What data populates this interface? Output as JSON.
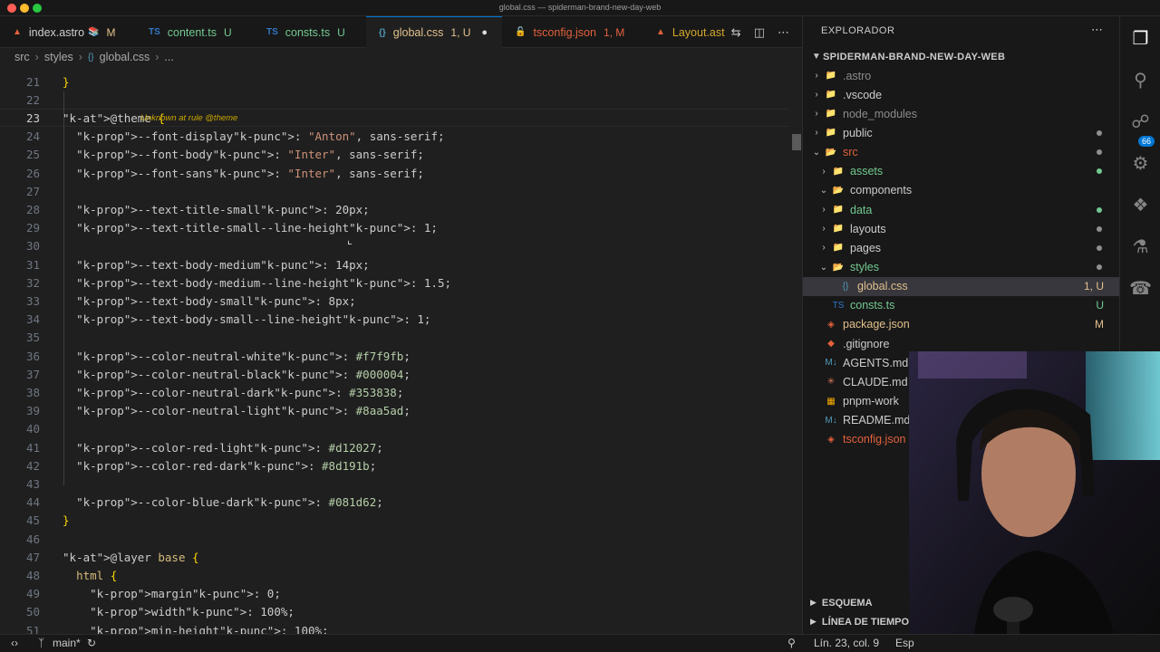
{
  "window": {
    "title": "global.css — spiderman-brand-new-day-web"
  },
  "tabs": [
    {
      "icon": "astro",
      "label": "index.astro",
      "status": "M",
      "extra": "📚"
    },
    {
      "icon": "TS",
      "label": "content.ts",
      "status": "U"
    },
    {
      "icon": "TS",
      "label": "consts.ts",
      "status": "U"
    },
    {
      "icon": "{}",
      "label": "global.css",
      "status": "1, U",
      "dirty": "●"
    },
    {
      "icon": "{}",
      "label": "tsconfig.json",
      "status": "1, M"
    },
    {
      "icon": "astro",
      "label": "Layout.ast"
    }
  ],
  "breadcrumb": {
    "seg1": "src",
    "seg2": "styles",
    "seg3_icon": "{}",
    "seg3": "global.css",
    "seg4": "..."
  },
  "editor": {
    "diagnostic": "Unknown at rule @theme",
    "lines": [
      {
        "n": "21",
        "text": "}"
      },
      {
        "n": "22",
        "text": ""
      },
      {
        "n": "23",
        "text": "@theme {"
      },
      {
        "n": "24",
        "text": "  --font-display: \"Anton\", sans-serif;"
      },
      {
        "n": "25",
        "text": "  --font-body: \"Inter\", sans-serif;"
      },
      {
        "n": "26",
        "text": "  --font-sans: \"Inter\", sans-serif;"
      },
      {
        "n": "27",
        "text": ""
      },
      {
        "n": "28",
        "text": "  --text-title-small: 20px;"
      },
      {
        "n": "29",
        "text": "  --text-title-small--line-height: 1;"
      },
      {
        "n": "30",
        "text": ""
      },
      {
        "n": "31",
        "text": "  --text-body-medium: 14px;"
      },
      {
        "n": "32",
        "text": "  --text-body-medium--line-height: 1.5;"
      },
      {
        "n": "33",
        "text": "  --text-body-small: 8px;"
      },
      {
        "n": "34",
        "text": "  --text-body-small--line-height: 1;"
      },
      {
        "n": "35",
        "text": ""
      },
      {
        "n": "36",
        "text": "  --color-neutral-white: #f7f9fb;"
      },
      {
        "n": "37",
        "text": "  --color-neutral-black: #000004;"
      },
      {
        "n": "38",
        "text": "  --color-neutral-dark: #353838;"
      },
      {
        "n": "39",
        "text": "  --color-neutral-light: #8aa5ad;"
      },
      {
        "n": "40",
        "text": ""
      },
      {
        "n": "41",
        "text": "  --color-red-light: #d12027;"
      },
      {
        "n": "42",
        "text": "  --color-red-dark: #8d191b;"
      },
      {
        "n": "43",
        "text": ""
      },
      {
        "n": "44",
        "text": "  --color-blue-dark: #081d62;"
      },
      {
        "n": "45",
        "text": "}"
      },
      {
        "n": "46",
        "text": ""
      },
      {
        "n": "47",
        "text": "@layer base {"
      },
      {
        "n": "48",
        "text": "  html {"
      },
      {
        "n": "49",
        "text": "    margin: 0;"
      },
      {
        "n": "50",
        "text": "    width: 100%;"
      },
      {
        "n": "51",
        "text": "    min-height: 100%;"
      }
    ]
  },
  "explorer": {
    "title": "EXPLORADOR",
    "root": "SPIDERMAN-BRAND-NEW-DAY-WEB",
    "items": [
      {
        "label": ".astro",
        "type": "folder",
        "depth": 1,
        "muted": true
      },
      {
        "label": ".vscode",
        "type": "folder",
        "depth": 1
      },
      {
        "label": "node_modules",
        "type": "folder",
        "depth": 1,
        "muted": true
      },
      {
        "label": "public",
        "type": "folder",
        "depth": 1,
        "dot": "#8f8f8f"
      },
      {
        "label": "src",
        "type": "folder-open",
        "depth": 1,
        "color": "#e2613c",
        "dot": "#8f8f8f"
      },
      {
        "label": "assets",
        "type": "folder",
        "depth": 2,
        "color": "#73c991",
        "dot": "#73c991"
      },
      {
        "label": "components",
        "type": "folder-open",
        "depth": 2
      },
      {
        "label": "data",
        "type": "folder",
        "depth": 2,
        "color": "#73c991",
        "dot": "#73c991"
      },
      {
        "label": "layouts",
        "type": "folder",
        "depth": 2,
        "dot": "#8f8f8f"
      },
      {
        "label": "pages",
        "type": "folder",
        "depth": 2,
        "dot": "#8f8f8f"
      },
      {
        "label": "styles",
        "type": "folder-open",
        "depth": 2,
        "color": "#73c991",
        "dot": "#8f8f8f"
      },
      {
        "label": "global.css",
        "type": "css",
        "depth": 3,
        "color": "#e2c08d",
        "status": "1, U",
        "selected": true
      },
      {
        "label": "consts.ts",
        "type": "ts",
        "depth": 2,
        "color": "#73c991",
        "status": "U"
      },
      {
        "label": "package.json",
        "type": "json",
        "depth": 1,
        "color": "#e2c08d",
        "status": "M"
      },
      {
        "label": ".gitignore",
        "type": "git",
        "depth": 1
      },
      {
        "label": "AGENTS.md",
        "type": "md",
        "depth": 1
      },
      {
        "label": "CLAUDE.md",
        "type": "claude",
        "depth": 1
      },
      {
        "label": "pnpm-work",
        "type": "pnpm",
        "depth": 1
      },
      {
        "label": "README.md",
        "type": "md",
        "depth": 1
      },
      {
        "label": "tsconfig.json",
        "type": "json",
        "depth": 1,
        "color": "#e2613c"
      }
    ],
    "sections": [
      "ESQUEMA",
      "LÍNEA DE TIEMPO"
    ]
  },
  "activity": {
    "source_control_badge": "66"
  },
  "status": {
    "branch": "main*",
    "position": "Lín. 23, col. 9",
    "spaces": "Esp"
  }
}
